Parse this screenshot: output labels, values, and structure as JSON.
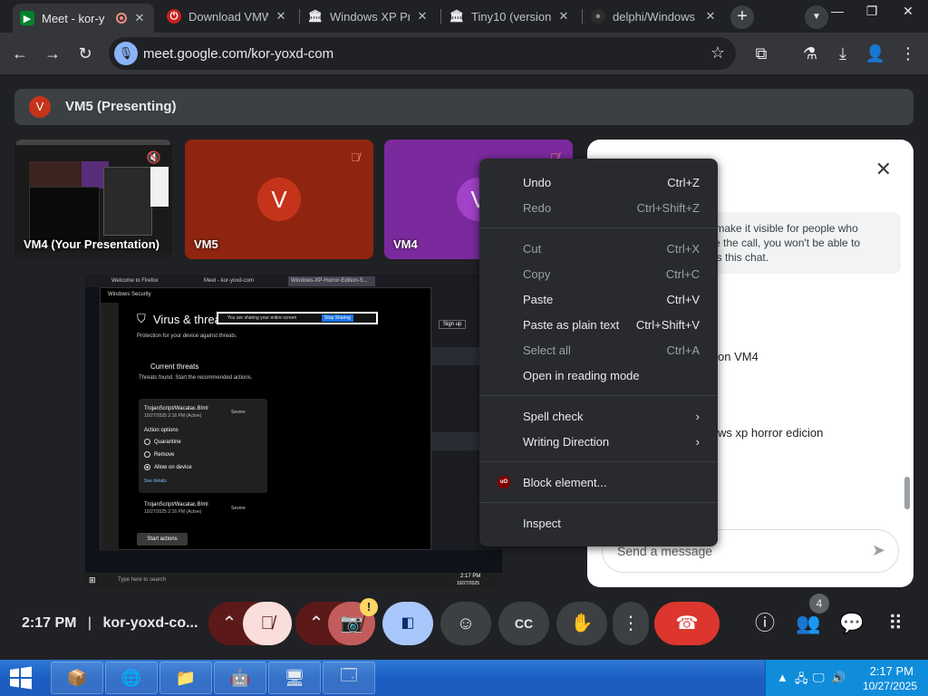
{
  "browser": {
    "tabs": [
      {
        "title": "Meet - kor-y",
        "favicon": "meet-icon",
        "active": true
      },
      {
        "title": "Download VMW",
        "favicon": "vmware-icon",
        "active": false
      },
      {
        "title": "Windows XP Pro",
        "favicon": "archive-icon",
        "active": false
      },
      {
        "title": "Tiny10 (version",
        "favicon": "archive-icon",
        "active": false
      },
      {
        "title": "delphi/Windows",
        "favicon": "github-icon",
        "active": false
      }
    ],
    "new_tab": "+",
    "url": "meet.google.com/kor-yoxd-com"
  },
  "meet": {
    "presenter_avatar": "V",
    "presenter_text": "VM5 (Presenting)",
    "tiles": [
      {
        "label": "VM4 (Your Presentation)",
        "type": "screen"
      },
      {
        "label": "VM5",
        "avatar": "V",
        "color": "#8f2510",
        "avatar_color": "#c5341a"
      },
      {
        "label": "VM4",
        "avatar": "V",
        "color": "#7b2a9e",
        "avatar_color": "#a142c9"
      }
    ],
    "shared": {
      "tabs": [
        "Welcome to Firefox",
        "Meet - kor-yoxd-com",
        "Windows-XP-Horror-Edition-S..."
      ],
      "window_title": "Windows Security",
      "heading": "Virus & threat",
      "sub": "Protection for your device against threats.",
      "current_threats": "Current threats",
      "threats_found": "Threats found. Start the recommended actions.",
      "threat1_name": "TrojanScript/Wacatac.B!ml",
      "threat1_date": "10/27/2025 2:16 PM (Active)",
      "threat1_severity": "Severe",
      "action_options": "Action options",
      "opt_quarantine": "Quarantine",
      "opt_remove": "Remove",
      "opt_allow": "Allow on device",
      "see_details": "See details",
      "threat2_name": "TrojanScript/Wacatac.B!ml",
      "threat2_date": "10/27/2025 2:16 PM (Active)",
      "threat2_severity": "Severe",
      "start_actions": "Start actions",
      "share_notice": "You are sharing your entire screen",
      "stop_sharing": "Stop Sharing",
      "taskbar_search": "Type here to search",
      "taskbar_time": "2:17 PM",
      "taskbar_date": "10/27/2025",
      "sign_up": "Sign up"
    },
    "chat": {
      "title_visible": "es",
      "note_lines": [
        "e to make it visible for people who",
        "leave the call, you won't be able to",
        "ccess this chat."
      ],
      "message1": "on VM4",
      "message2": "ws xp horror edicion",
      "input_placeholder": "Send a message"
    },
    "bottom": {
      "time": "2:17 PM",
      "separator": "|",
      "meeting_code": "kor-yoxd-co...",
      "warn": "!",
      "people_count": "4"
    }
  },
  "context_menu": {
    "groups": [
      [
        {
          "label": "Undo",
          "shortcut": "Ctrl+Z",
          "enabled": true
        },
        {
          "label": "Redo",
          "shortcut": "Ctrl+Shift+Z",
          "enabled": false
        }
      ],
      [
        {
          "label": "Cut",
          "shortcut": "Ctrl+X",
          "enabled": false
        },
        {
          "label": "Copy",
          "shortcut": "Ctrl+C",
          "enabled": false
        },
        {
          "label": "Paste",
          "shortcut": "Ctrl+V",
          "enabled": true
        },
        {
          "label": "Paste as plain text",
          "shortcut": "Ctrl+Shift+V",
          "enabled": true
        },
        {
          "label": "Select all",
          "shortcut": "Ctrl+A",
          "enabled": false
        },
        {
          "label": "Open in reading mode",
          "shortcut": "",
          "enabled": true
        }
      ],
      [
        {
          "label": "Spell check",
          "submenu": true,
          "enabled": true
        },
        {
          "label": "Writing Direction",
          "submenu": true,
          "enabled": true
        }
      ],
      [
        {
          "label": "Block element...",
          "icon_text": "uO",
          "enabled": true
        }
      ],
      [
        {
          "label": "Inspect",
          "enabled": true
        }
      ]
    ]
  },
  "taskbar": {
    "time": "2:17 PM",
    "date": "10/27/2025"
  }
}
